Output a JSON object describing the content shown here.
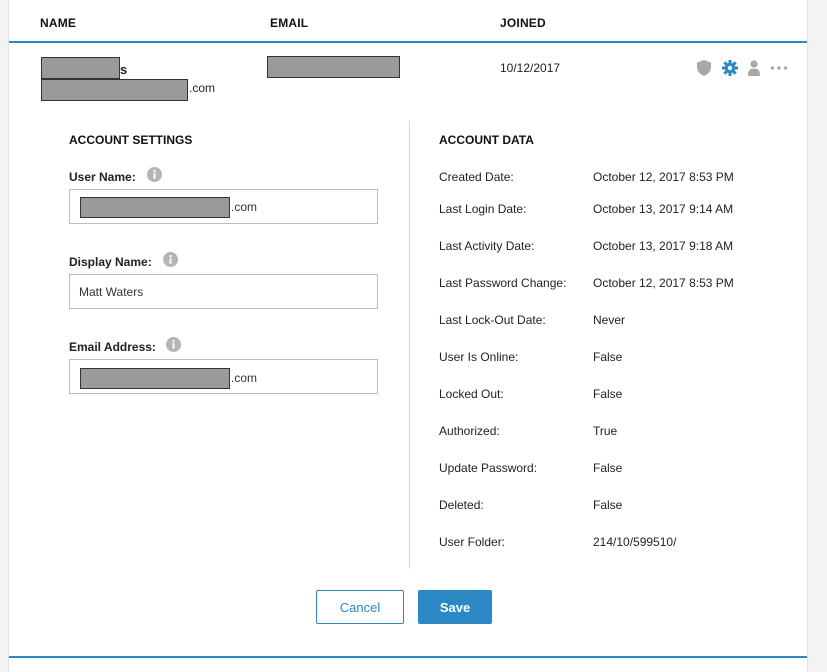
{
  "table": {
    "headers": {
      "name": "NAME",
      "email": "EMAIL",
      "joined": "JOINED"
    }
  },
  "user_row": {
    "name_suffix": "s",
    "name_email_suffix": ".com",
    "joined": "10/12/2017",
    "icons": [
      "shield-icon",
      "gear-icon",
      "person-icon",
      "more-icon"
    ]
  },
  "account_settings": {
    "title": "ACCOUNT SETTINGS",
    "user_name_label": "User Name:",
    "user_name_suffix": ".com",
    "display_name_label": "Display Name:",
    "display_name_value": "Matt Waters",
    "email_label": "Email Address:",
    "email_suffix": ".com"
  },
  "account_data": {
    "title": "ACCOUNT DATA",
    "rows": [
      {
        "label": "Created Date:",
        "value": "October 12, 2017 8:53 PM"
      },
      {
        "label": "Last Login Date:",
        "value": "October 13, 2017 9:14 AM"
      },
      {
        "label": "Last Activity Date:",
        "value": "October 13, 2017 9:18 AM"
      },
      {
        "label": "Last Password Change:",
        "value": "October 12, 2017 8:53 PM"
      },
      {
        "label": "Last Lock-Out Date:",
        "value": "Never"
      },
      {
        "label": "User Is Online:",
        "value": "False"
      },
      {
        "label": "Locked Out:",
        "value": "False"
      },
      {
        "label": "Authorized:",
        "value": "True"
      },
      {
        "label": "Update Password:",
        "value": "False"
      },
      {
        "label": "Deleted:",
        "value": "False"
      },
      {
        "label": "User Folder:",
        "value": "214/10/599510/"
      }
    ]
  },
  "actions": {
    "cancel_label": "Cancel",
    "save_label": "Save"
  },
  "colors": {
    "accent": "#2b88c4",
    "icon_gray": "#a9a9a9",
    "redaction": "#9a9a9a"
  }
}
